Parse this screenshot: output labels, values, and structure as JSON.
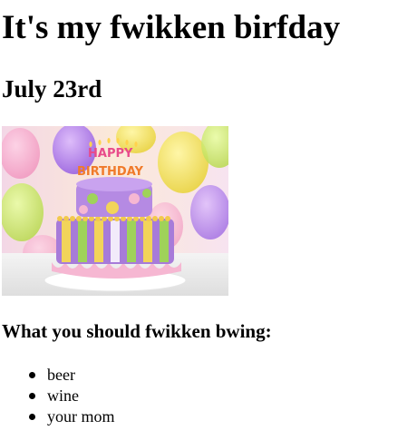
{
  "title": "It's my fwikken birfday",
  "date": "July 23rd",
  "image": {
    "candle_text_top": "HAPPY",
    "candle_text_bottom": "BIRTHDAY"
  },
  "list_heading": "What you should fwikken bwing:",
  "bring_items": [
    "beer",
    "wine",
    "your mom"
  ],
  "colors": {
    "text": "#000000",
    "background": "#ffffff"
  }
}
